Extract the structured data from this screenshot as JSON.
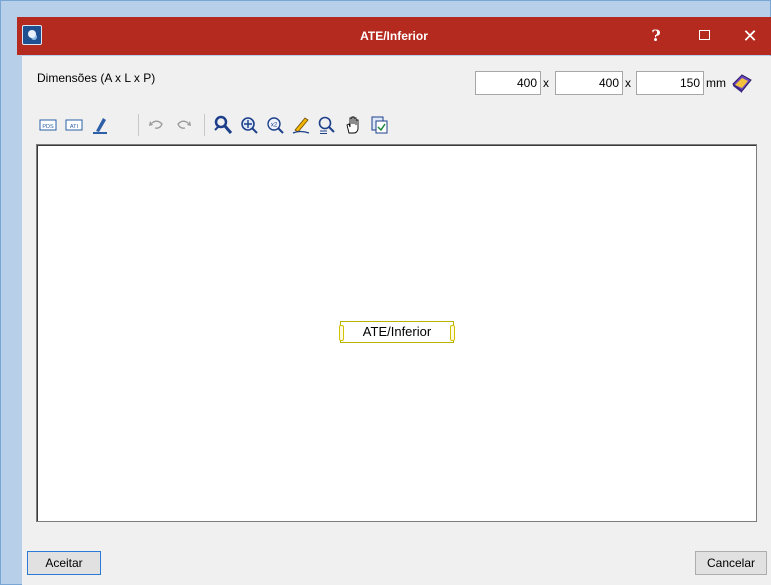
{
  "window": {
    "title": "ATE/Inferior",
    "help_glyph": "?",
    "close_glyph": "✕"
  },
  "dimensions": {
    "label": "Dimensões (A x L x P)",
    "a_value": "400",
    "l_value": "400",
    "p_value": "150",
    "separator": "x",
    "unit": "mm"
  },
  "toolbar": {
    "tools": [
      {
        "name": "pds-import-icon",
        "label": "PDS"
      },
      {
        "name": "ati-import-icon",
        "label": "ATI"
      },
      {
        "name": "edit-icon"
      },
      {
        "name": "undo-icon"
      },
      {
        "name": "redo-icon"
      },
      {
        "name": "zoom-extents-icon"
      },
      {
        "name": "zoom-window-icon"
      },
      {
        "name": "zoom-x2-icon",
        "label": "x2"
      },
      {
        "name": "draw-pen-icon"
      },
      {
        "name": "zoom-previous-icon"
      },
      {
        "name": "pan-hand-icon"
      },
      {
        "name": "copy-view-icon"
      }
    ]
  },
  "canvas": {
    "element_label": "ATE/Inferior"
  },
  "footer": {
    "accept_label": "Aceitar",
    "cancel_label": "Cancelar"
  },
  "colors": {
    "titlebar": "#b52a1f",
    "window_border": "#7aa6d6",
    "client_bg": "#f0f0f0",
    "accent_blue": "#1d4f91",
    "label_border": "#b7b300"
  }
}
